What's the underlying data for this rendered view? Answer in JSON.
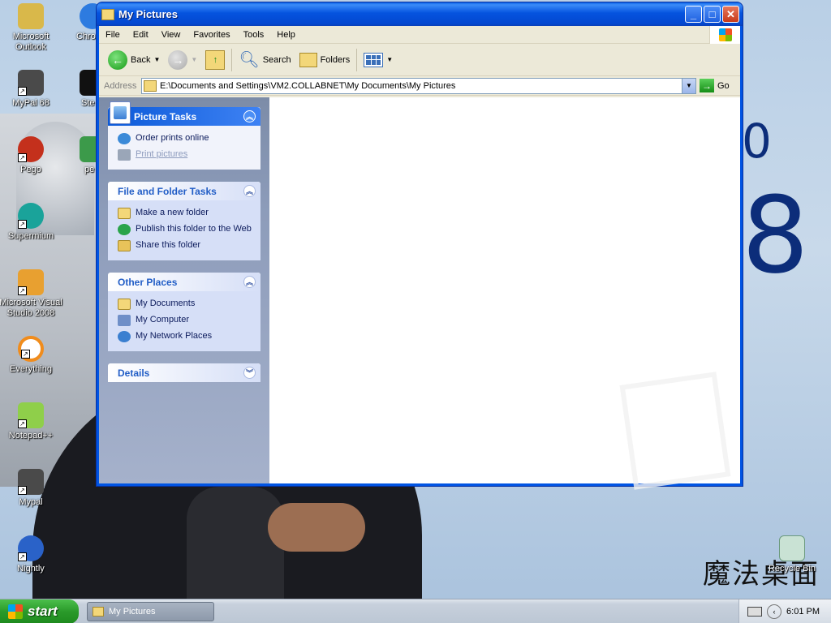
{
  "desktop": {
    "icons": [
      {
        "label": "Microsoft Outlook",
        "icon": "outlook-icon",
        "color": "#d9b84a"
      },
      {
        "label": "MyPal 68",
        "icon": "mypal-icon",
        "color": "#4a4a4a"
      },
      {
        "label": "Pego",
        "icon": "pego-icon",
        "color": "#c4301c"
      },
      {
        "label": "Supermium",
        "icon": "supermium-icon",
        "color": "#1aa39a"
      },
      {
        "label": "Microsoft Visual Studio 2008",
        "icon": "visual-studio-icon",
        "color": "#e8a030"
      },
      {
        "label": "Everything",
        "icon": "everything-icon",
        "color": "#f08c1c"
      },
      {
        "label": "Notepad++",
        "icon": "notepadpp-icon",
        "color": "#8fcf4a"
      },
      {
        "label": "Mypal",
        "icon": "mypal-icon",
        "color": "#4a4a4a"
      },
      {
        "label": "Nightly",
        "icon": "nightly-icon",
        "color": "#2a62c8"
      }
    ],
    "partial_icons": [
      {
        "label": "Chro",
        "icon": "chrome-icon"
      },
      {
        "label": "Ste",
        "icon": "steam-icon"
      },
      {
        "label": "pe",
        "icon": "app-icon"
      }
    ],
    "recycle_bin": "Recycle Bin",
    "wallpaper_numbers": [
      "0",
      "8"
    ],
    "wallpaper_logo": "魔法桌面"
  },
  "window": {
    "title": "My Pictures",
    "menu": [
      "File",
      "Edit",
      "View",
      "Favorites",
      "Tools",
      "Help"
    ],
    "toolbar": {
      "back": "Back",
      "search": "Search",
      "folders": "Folders"
    },
    "address": {
      "label": "Address",
      "value": "E:\\Documents and Settings\\VM2.COLLABNET\\My Documents\\My Pictures",
      "go": "Go"
    },
    "panels": [
      {
        "title": "Picture Tasks",
        "items": [
          {
            "label": "Order prints online",
            "icon": "globe-icon",
            "color": "#3b8ad8"
          },
          {
            "label": "Print pictures",
            "icon": "printer-icon",
            "color": "#9aa6b8"
          }
        ]
      },
      {
        "title": "File and Folder Tasks",
        "items": [
          {
            "label": "Make a new folder",
            "icon": "new-folder-icon",
            "color": "#f3d779"
          },
          {
            "label": "Publish this folder to the Web",
            "icon": "publish-web-icon",
            "color": "#2aa44a"
          },
          {
            "label": "Share this folder",
            "icon": "share-folder-icon",
            "color": "#e8c35a"
          }
        ]
      },
      {
        "title": "Other Places",
        "items": [
          {
            "label": "My Documents",
            "icon": "my-documents-icon",
            "color": "#f3d779"
          },
          {
            "label": "My Computer",
            "icon": "my-computer-icon",
            "color": "#6f8fc8"
          },
          {
            "label": "My Network Places",
            "icon": "network-places-icon",
            "color": "#3a7fd0"
          }
        ]
      },
      {
        "title": "Details",
        "items": []
      }
    ]
  },
  "taskbar": {
    "start": "start",
    "task": "My Pictures",
    "time": "6:01 PM"
  }
}
